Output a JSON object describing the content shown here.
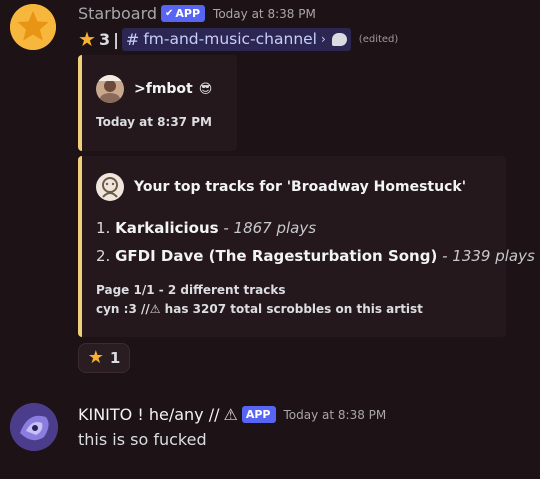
{
  "starboard_message": {
    "username": "Starboard",
    "badge": "APP",
    "badge_check": "✔",
    "timestamp": "Today at 8:38 PM",
    "star_emoji": "★",
    "star_count": "3",
    "separator": "|",
    "channel_hash": "#",
    "channel_name": "fm-and-music-channel",
    "channel_chevron": "›",
    "thread_icon": "speech-bubble-icon",
    "edited_label": "(edited)",
    "embed_quote": {
      "author": ">fmbot",
      "author_icon": "😎",
      "time": "Today at 8:37 PM"
    },
    "embed_tracks": {
      "title": "Your top tracks for 'Broadway Homestuck'",
      "tracks": [
        {
          "rank": "1.",
          "name": "Karkalicious",
          "sep": " - ",
          "plays": "1867 plays"
        },
        {
          "rank": "2.",
          "name": "GFDI Dave (The Ragesturbation Song)",
          "sep": " - ",
          "plays": "1339 plays"
        }
      ],
      "footer_line1": "Page 1/1 - 2 different tracks",
      "footer_line2": "cyn :3 //⚠ has 3207 total scrobbles on this artist"
    },
    "reaction": {
      "emoji": "★",
      "count": "1"
    }
  },
  "kinito_message": {
    "username": "KINITO ! he/any //",
    "warn_icon": "⚠",
    "badge": "APP",
    "timestamp": "Today at 8:38 PM",
    "text": "this is so fucked"
  },
  "colors": {
    "background": "#1d1216",
    "app_badge": "#5865f2",
    "embed_accent": "#f0d078",
    "star": "#f8b132",
    "mention_bg": "#2c2752"
  }
}
